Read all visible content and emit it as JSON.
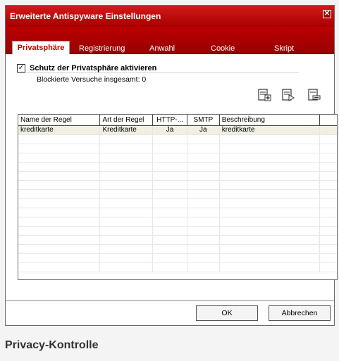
{
  "window": {
    "title": "Erweiterte Antispyware Einstellungen"
  },
  "tabs": [
    "Privatsphäre",
    "Registrierung",
    "Anwahl",
    "Cookie",
    "Skript"
  ],
  "privacy": {
    "checkbox_label": "Schutz der Privatsphäre aktivieren",
    "checked": true,
    "blocked_text": "Blockierte Versuche insgesamt: 0"
  },
  "toolbar": [
    "add-rule-icon",
    "edit-rule-icon",
    "delete-rule-icon"
  ],
  "table": {
    "columns": [
      "Name der Regel",
      "Art der Regel",
      "HTTP-...",
      "SMTP",
      "Beschreibung"
    ],
    "rows": [
      [
        "kreditkarte",
        "Kreditkarte",
        "Ja",
        "Ja",
        "kreditkarte"
      ]
    ]
  },
  "buttons": {
    "ok": "OK",
    "cancel": "Abbrechen"
  },
  "caption": "Privacy-Kontrolle"
}
